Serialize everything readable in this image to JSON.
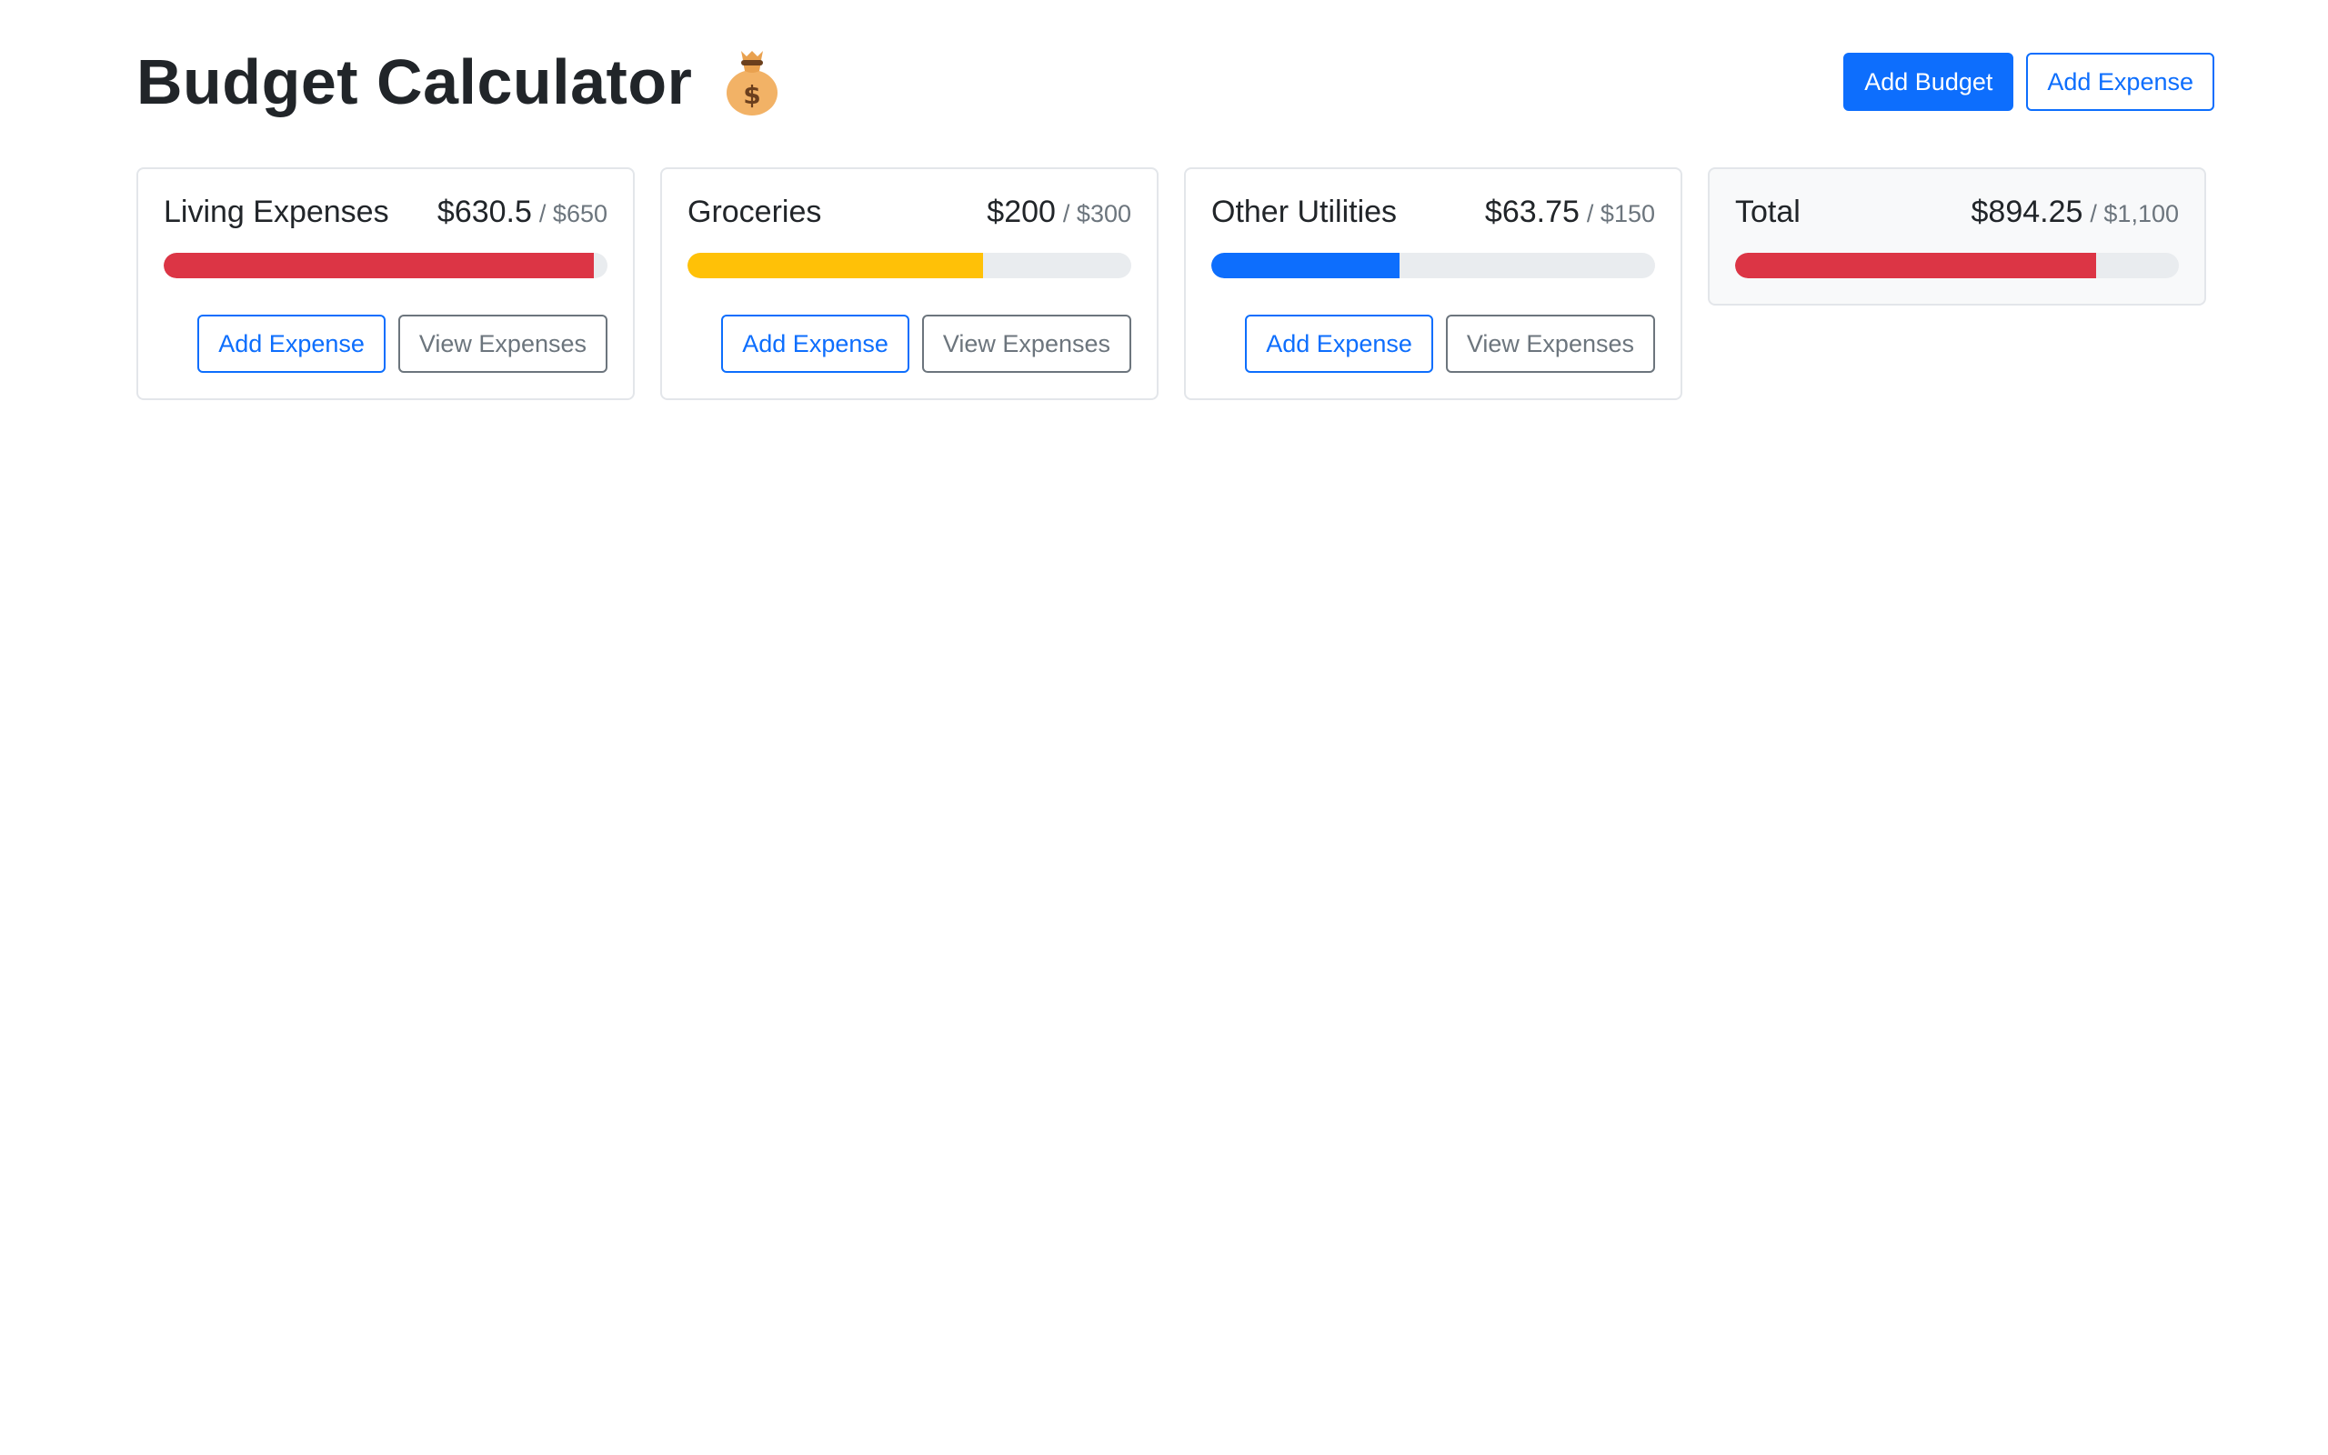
{
  "header": {
    "title": "Budget Calculator",
    "icon": "money-bag-icon",
    "add_budget_label": "Add Budget",
    "add_expense_label": "Add Expense"
  },
  "colors": {
    "primary": "#0d6efd",
    "danger": "#dc3545",
    "warning": "#ffc107",
    "track": "#e9ecef"
  },
  "budgets": [
    {
      "name": "Living Expenses",
      "amount": "$630.5",
      "max": "/ $650",
      "progress": 0.97,
      "color": "#dc3545",
      "add_label": "Add Expense",
      "view_label": "View Expenses"
    },
    {
      "name": "Groceries",
      "amount": "$200",
      "max": "/ $300",
      "progress": 0.667,
      "color": "#ffc107",
      "add_label": "Add Expense",
      "view_label": "View Expenses"
    },
    {
      "name": "Other Utilities",
      "amount": "$63.75",
      "max": "/ $150",
      "progress": 0.425,
      "color": "#0d6efd",
      "add_label": "Add Expense",
      "view_label": "View Expenses"
    }
  ],
  "total": {
    "name": "Total",
    "amount": "$894.25",
    "max": "/ $1,100",
    "progress": 0.813,
    "color": "#dc3545"
  }
}
